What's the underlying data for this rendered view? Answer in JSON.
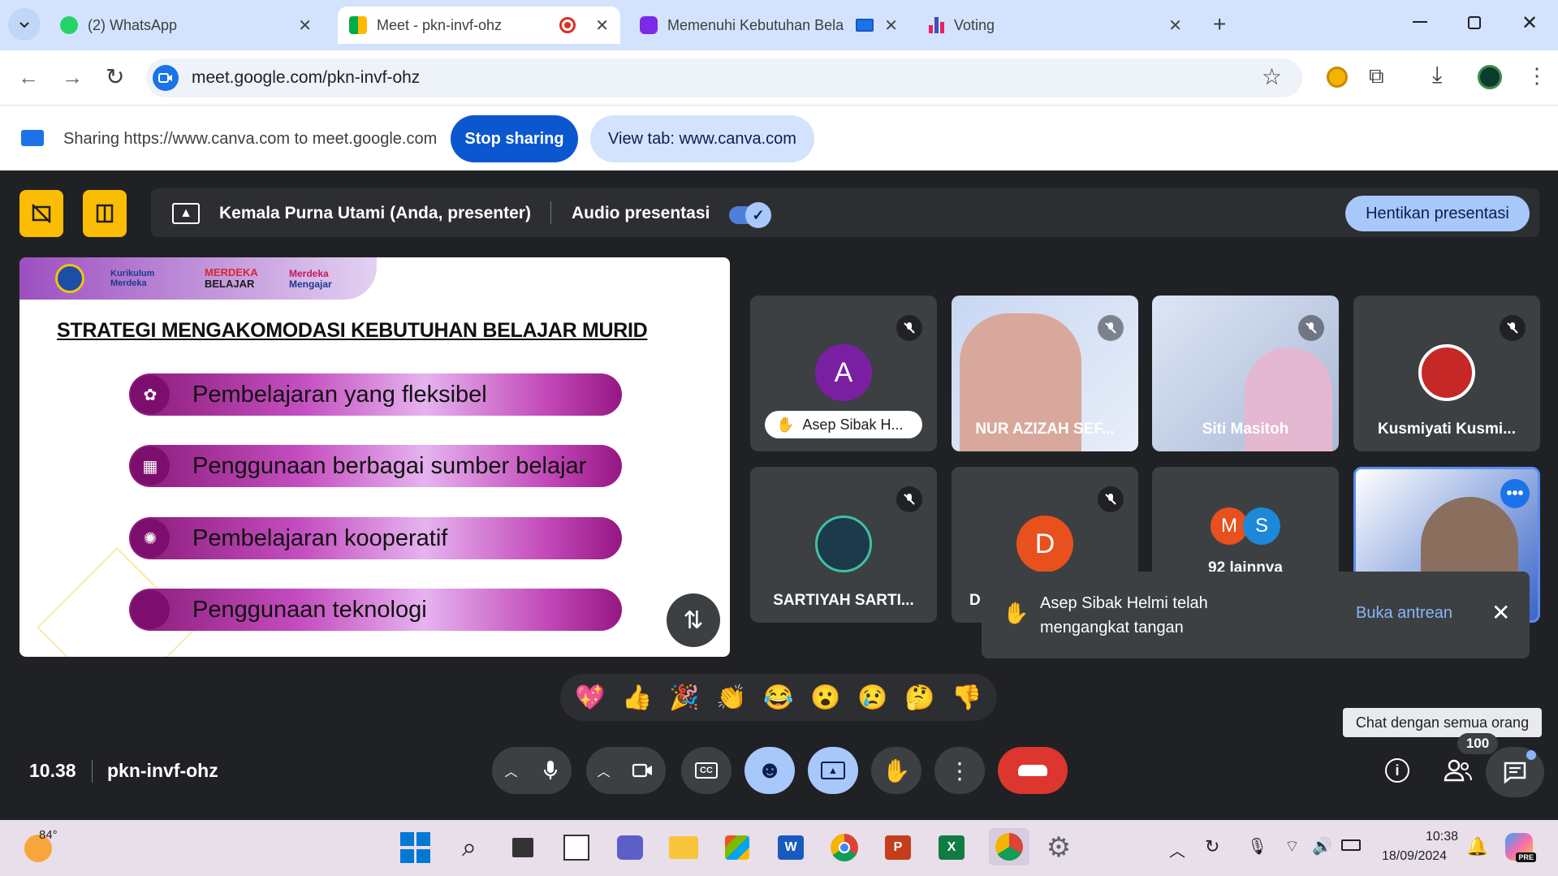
{
  "browser": {
    "tabs": [
      {
        "title": "(2) WhatsApp"
      },
      {
        "title": "Meet - pkn-invf-ohz"
      },
      {
        "title": "Memenuhi Kebutuhan Bela"
      },
      {
        "title": "Voting"
      }
    ],
    "url": "meet.google.com/pkn-invf-ohz"
  },
  "share_bar": {
    "text": "Sharing https://www.canva.com to meet.google.com",
    "stop_label": "Stop sharing",
    "view_label": "View tab: www.canva.com"
  },
  "presentation_bar": {
    "presenter": "Kemala Purna Utami (Anda, presenter)",
    "audio_label": "Audio presentasi",
    "stop_label": "Hentikan presentasi"
  },
  "slide": {
    "logos": [
      "Kurikulum",
      "Merdeka",
      "MERDEKA",
      "BELAJAR",
      "Merdeka",
      "Mengajar"
    ],
    "title": "STRATEGI MENGAKOMODASI KEBUTUHAN BELAJAR MURID",
    "items": [
      "Pembelajaran yang fleksibel",
      "Penggunaan berbagai sumber belajar",
      "Pembelajaran kooperatif",
      "Penggunaan teknologi"
    ]
  },
  "participants": [
    {
      "name": "Asep Sibak H...",
      "initial": "A",
      "color": "#7b1fa2"
    },
    {
      "name": "NUR AZIZAH SEF..."
    },
    {
      "name": "Siti Masitoh"
    },
    {
      "name": "Kusmiyati Kusmi..."
    },
    {
      "name": "SARTIYAH SARTI..."
    },
    {
      "name": "D",
      "initial": "D",
      "color": "#e8501e"
    },
    {
      "name": "92 lainnya",
      "initials": [
        "M",
        "S"
      ],
      "colors": [
        "#e8501e",
        "#1e88d8"
      ]
    }
  ],
  "toast": {
    "message_line1": "Asep Sibak Helmi telah",
    "message_line2": "mengangkat tangan",
    "action": "Buka antrean"
  },
  "reactions": [
    "💖",
    "👍",
    "🎉",
    "👏",
    "😂",
    "😮",
    "😢",
    "🤔",
    "👎"
  ],
  "bottom": {
    "time": "10.38",
    "meeting_code": "pkn-invf-ohz",
    "tooltip": "Chat dengan semua orang",
    "people_count": "100"
  },
  "taskbar": {
    "weather": "84°",
    "clock_time": "10:38",
    "clock_date": "18/09/2024",
    "pre_badge": "PRE"
  }
}
